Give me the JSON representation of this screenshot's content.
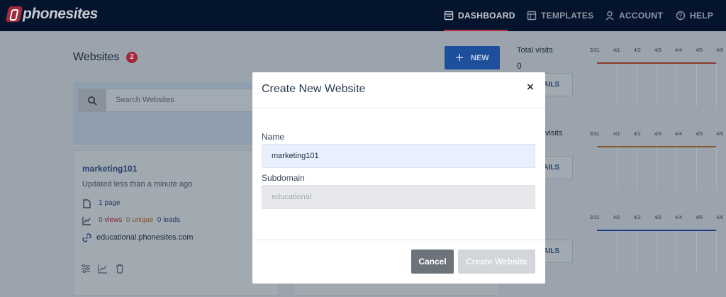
{
  "brand": {
    "name": "phonesites"
  },
  "nav": {
    "items": [
      {
        "label": "DASHBOARD",
        "icon": "dashboard-icon",
        "active": true
      },
      {
        "label": "TEMPLATES",
        "icon": "templates-icon",
        "active": false
      },
      {
        "label": "ACCOUNT",
        "icon": "user-icon",
        "active": false
      },
      {
        "label": "HELP",
        "icon": "help-icon",
        "active": false
      }
    ]
  },
  "websites": {
    "title": "Websites",
    "count": "2",
    "new_label": "NEW",
    "search_placeholder": "Search Websites",
    "card": {
      "name": "marketing101",
      "updated": "Updated  less than a minute ago",
      "pages": "1 page",
      "views": "0 views",
      "unique": "0 unique",
      "leads": "0 leads",
      "domain": "educational.phonesites.com"
    }
  },
  "stats": {
    "total_visits_label": "Total visits",
    "total_visits_value": "0",
    "visits_label": "visits",
    "details_label": "AILS",
    "chart_dates": [
      "3/31",
      "4/1",
      "4/2",
      "4/3",
      "4/4",
      "4/5",
      "4/6"
    ],
    "line_colors": [
      "#8a3a2a",
      "#8a5a2a",
      "#1d3f8a"
    ]
  },
  "modal": {
    "title": "Create New Website",
    "close": "×",
    "name_label": "Name",
    "name_value": "marketing101",
    "subdomain_label": "Subdomain",
    "subdomain_placeholder": "educational",
    "cancel_label": "Cancel",
    "create_label": "Create Website"
  },
  "colors": {
    "nav_bg": "#05142d",
    "accent": "#b2344a",
    "primary": "#1d4f9a"
  }
}
